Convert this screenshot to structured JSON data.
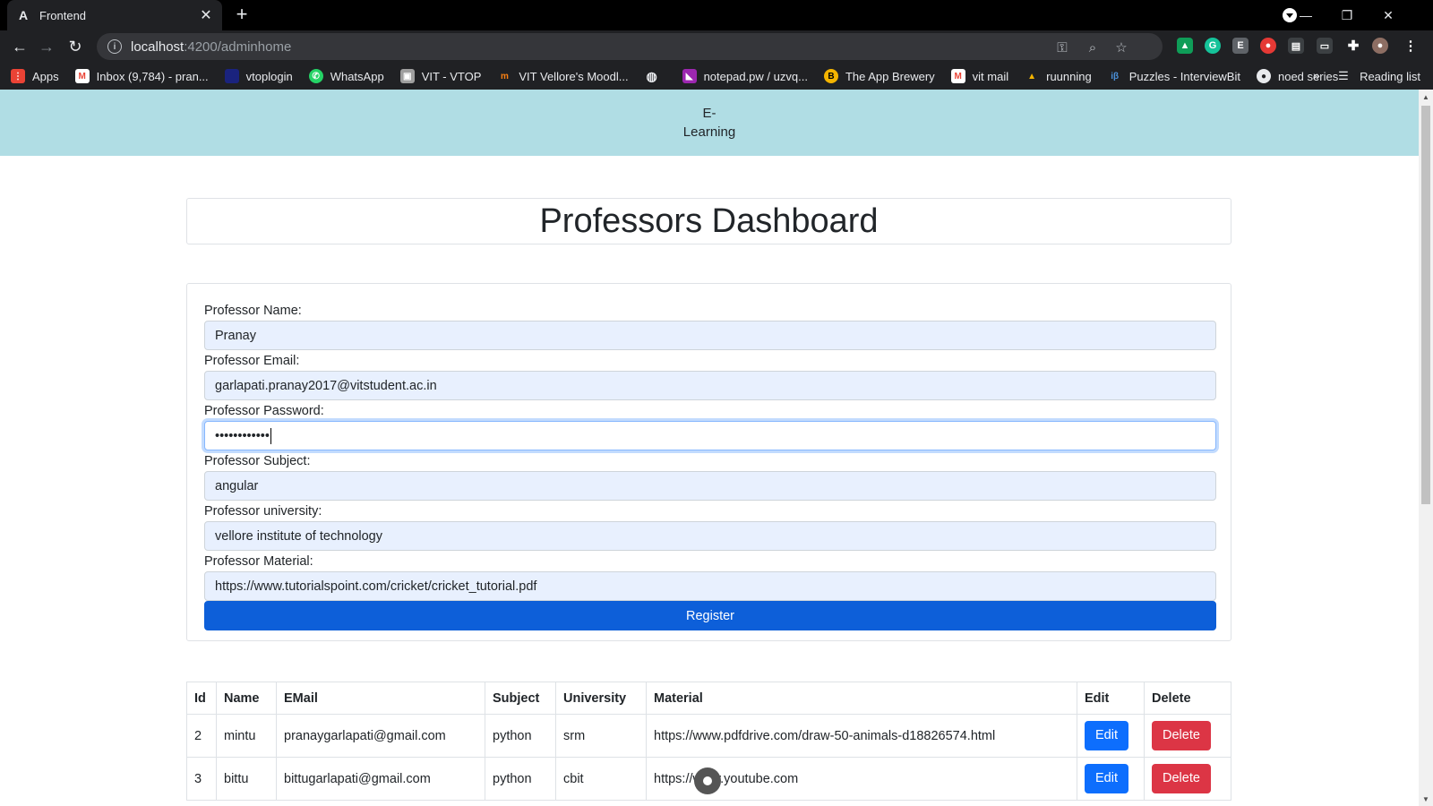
{
  "browser": {
    "tab_title": "Frontend",
    "tab_favicon": "A",
    "url_host": "localhost",
    "url_path": ":4200/adminhome",
    "bookmarks": [
      {
        "label": "Apps",
        "icon": "apps-grid-icon",
        "color": "#ea4335"
      },
      {
        "label": "Inbox (9,784) - pran...",
        "icon": "gmail-icon",
        "color": "#ea4335"
      },
      {
        "label": "vtoplogin",
        "icon": "vtop-icon",
        "color": "#1a237e"
      },
      {
        "label": "WhatsApp",
        "icon": "whatsapp-icon",
        "color": "#25d366"
      },
      {
        "label": "VIT - VTOP",
        "icon": "vit-icon",
        "color": "#9e9e9e"
      },
      {
        "label": "VIT Vellore's Moodl...",
        "icon": "moodle-icon",
        "color": "#f98012"
      },
      {
        "label": "",
        "icon": "globe-icon",
        "color": "#e8eaed"
      },
      {
        "label": "notepad.pw / uzvq...",
        "icon": "notepad-icon",
        "color": "#9c27b0"
      },
      {
        "label": "The App Brewery",
        "icon": "app-brewery-icon",
        "color": "#f4b400"
      },
      {
        "label": "vit mail",
        "icon": "gmail-icon",
        "color": "#ea4335"
      },
      {
        "label": "ruunning",
        "icon": "running-icon",
        "color": "#f4b400"
      },
      {
        "label": "Puzzles - InterviewBit",
        "icon": "interviewbit-icon",
        "color": "#4a90d9"
      },
      {
        "label": "noed series",
        "icon": "github-icon",
        "color": "#e8eaed"
      }
    ],
    "reading_list_label": "Reading list"
  },
  "navbar": {
    "brand_line1": "E-",
    "brand_line2": "Learning"
  },
  "page": {
    "title": "Professors Dashboard"
  },
  "form": {
    "name_label": "Professor Name:",
    "name_value": "Pranay",
    "email_label": "Professor Email:",
    "email_value": "garlapati.pranay2017@vitstudent.ac.in",
    "password_label": "Professor Password:",
    "password_value": "••••••••••••",
    "subject_label": "Professor Subject:",
    "subject_value": "angular",
    "university_label": "Professor university:",
    "university_value": "vellore institute of technology",
    "material_label": "Professor Material:",
    "material_value": "https://www.tutorialspoint.com/cricket/cricket_tutorial.pdf",
    "register_label": "Register"
  },
  "table": {
    "headers": [
      "Id",
      "Name",
      "EMail",
      "Subject",
      "University",
      "Material",
      "Edit",
      "Delete"
    ],
    "rows": [
      {
        "id": "2",
        "name": "mintu",
        "email": "pranaygarlapati@gmail.com",
        "subject": "python",
        "university": "srm",
        "material": "https://www.pdfdrive.com/draw-50-animals-d18826574.html",
        "edit": "Edit",
        "delete": "Delete"
      },
      {
        "id": "3",
        "name": "bittu",
        "email": "bittugarlapati@gmail.com",
        "subject": "python",
        "university": "cbit",
        "material": "https://www.youtube.com",
        "edit": "Edit",
        "delete": "Delete"
      }
    ]
  },
  "colors": {
    "navbar_bg": "#b0dde4",
    "primary": "#0d6efd",
    "danger": "#dc3545",
    "autofill_bg": "#e8f0fe"
  }
}
